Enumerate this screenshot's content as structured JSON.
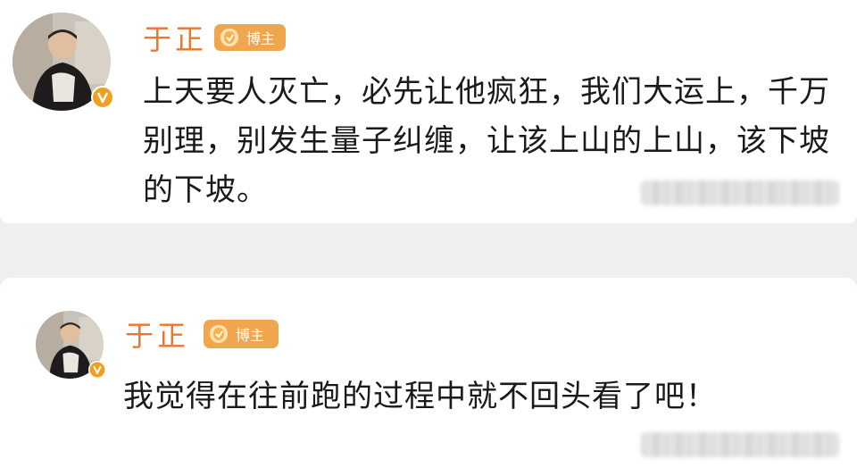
{
  "posts": [
    {
      "author": "于正",
      "badge_label": "博主",
      "text": "上天要人灭亡，必先让他疯狂，我们大运上，千万别理，别发生量子纠缠，让该上山的上山，该下坡的下坡。"
    },
    {
      "author": "于正",
      "badge_label": "博主",
      "text": "我觉得在往前跑的过程中就不回头看了吧！"
    }
  ],
  "colors": {
    "author_name": "#e8782f",
    "badge_bg": "#f0a64e",
    "verified_badge": "#f0a020",
    "page_bg": "#efefef",
    "card_bg": "#ffffff",
    "text": "#1a1a1a"
  },
  "icons": {
    "avatar": "avatar",
    "verified": "verified-v-icon",
    "badge": "blogger-badge-icon"
  }
}
